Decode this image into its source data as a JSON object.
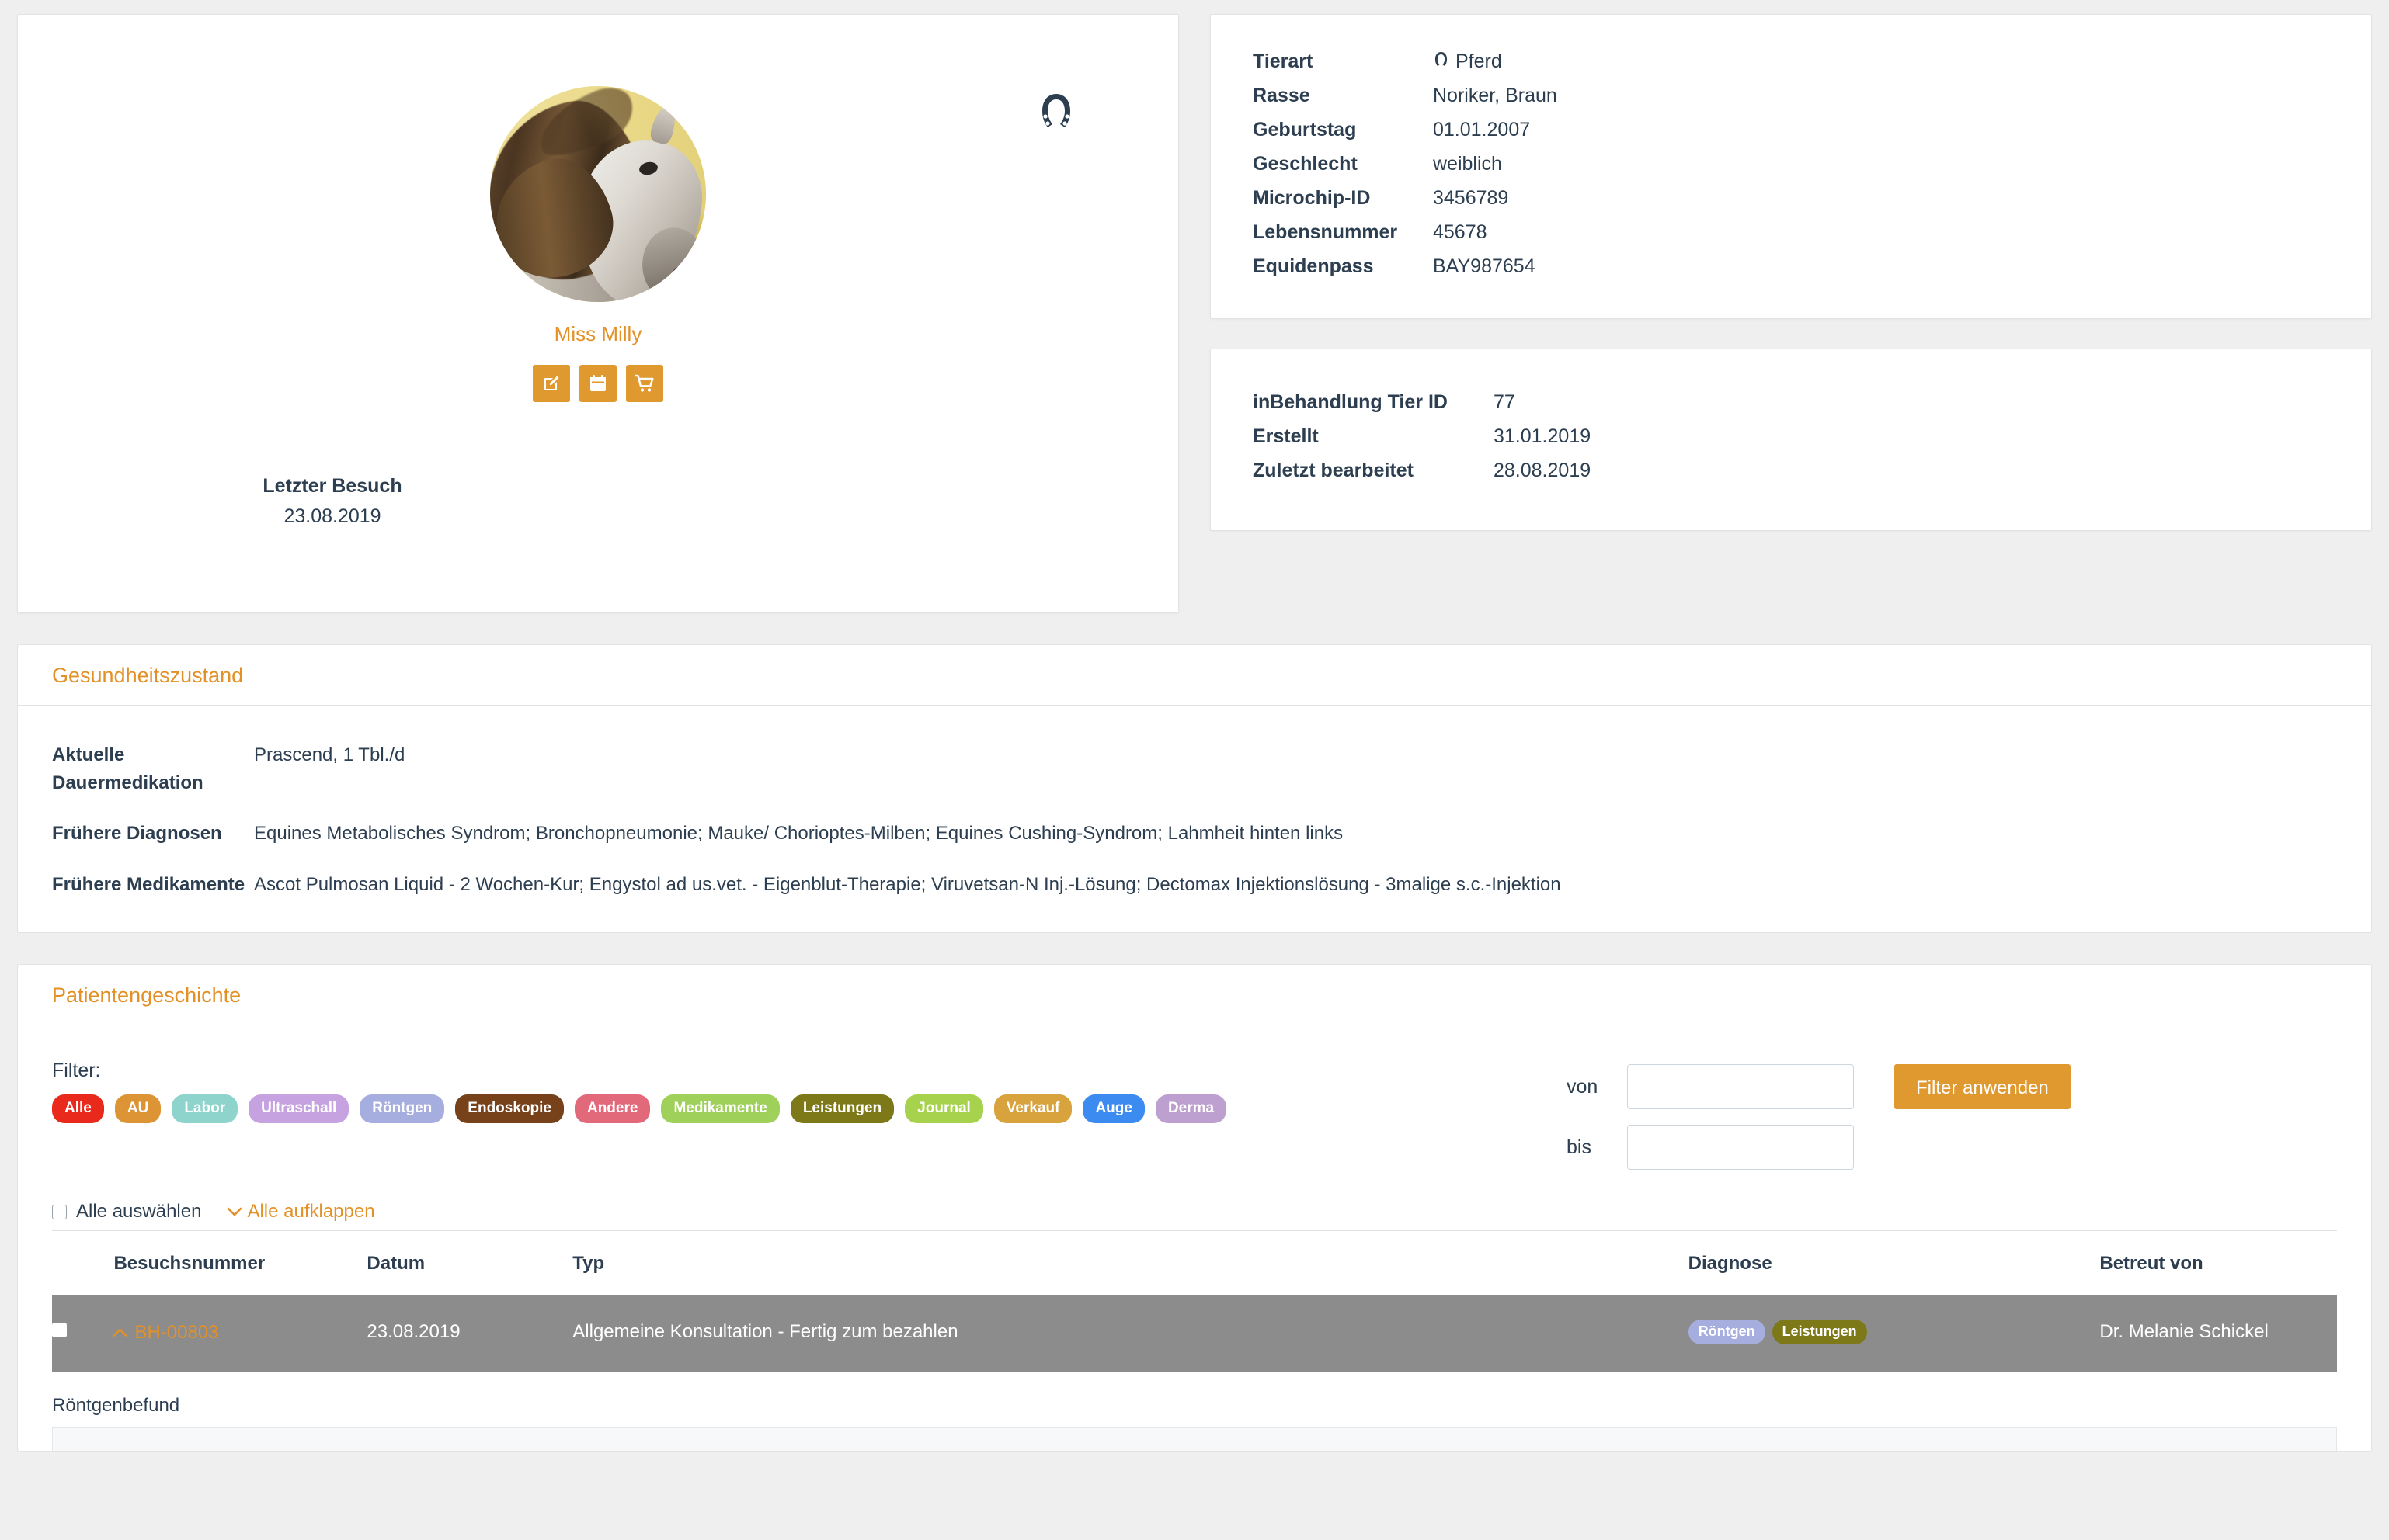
{
  "pet": {
    "name": "Miss Milly",
    "species_icon": "horseshoe-icon",
    "last_visit_label": "Letzter Besuch",
    "last_visit_date": "23.08.2019",
    "actions": [
      {
        "name": "edit-button",
        "icon": "pencil-square-icon"
      },
      {
        "name": "appointment-button",
        "icon": "calendar-icon"
      },
      {
        "name": "sell-button",
        "icon": "cart-icon"
      }
    ]
  },
  "details": [
    {
      "key": "Tierart",
      "value": "Pferd",
      "icon": "horseshoe-icon"
    },
    {
      "key": "Rasse",
      "value": "Noriker, Braun"
    },
    {
      "key": "Geburtstag",
      "value": "01.01.2007"
    },
    {
      "key": "Geschlecht",
      "value": "weiblich"
    },
    {
      "key": "Microchip-ID",
      "value": "3456789"
    },
    {
      "key": "Lebensnummer",
      "value": "45678"
    },
    {
      "key": "Equidenpass",
      "value": "BAY987654"
    }
  ],
  "meta": [
    {
      "key": "inBehandlung Tier ID",
      "value": "77"
    },
    {
      "key": "Erstellt",
      "value": "31.01.2019"
    },
    {
      "key": "Zuletzt bearbeitet",
      "value": "28.08.2019"
    }
  ],
  "health": {
    "title": "Gesundheitszustand",
    "rows": [
      {
        "key": "Aktuelle Dauermedikation",
        "value": "Prascend, 1 Tbl./d"
      },
      {
        "key": "Frühere Diagnosen",
        "value": "Equines Metabolisches Syndrom; Bronchopneumonie; Mauke/ Chorioptes-Milben; Equines Cushing-Syndrom; Lahmheit hinten links"
      },
      {
        "key": "Frühere Medikamente",
        "value": "Ascot Pulmosan Liquid - 2 Wochen-Kur; Engystol ad us.vet. - Eigenblut-Therapie; Viruvetsan-N Inj.-Lösung; Dectomax Injektionslösung - 3malige s.c.-Injektion"
      }
    ]
  },
  "history": {
    "title": "Patientengeschichte",
    "filter_label": "Filter:",
    "tags": [
      {
        "label": "Alle",
        "color": "#e8291c"
      },
      {
        "label": "AU",
        "color": "#dd9434"
      },
      {
        "label": "Labor",
        "color": "#8ed3cc"
      },
      {
        "label": "Ultraschall",
        "color": "#c6a3e0"
      },
      {
        "label": "Röntgen",
        "color": "#a6aee0"
      },
      {
        "label": "Endoskopie",
        "color": "#77411a"
      },
      {
        "label": "Andere",
        "color": "#e2697a"
      },
      {
        "label": "Medikamente",
        "color": "#9ed05a"
      },
      {
        "label": "Leistungen",
        "color": "#7d7918"
      },
      {
        "label": "Journal",
        "color": "#a6d24e"
      },
      {
        "label": "Verkauf",
        "color": "#d8a33c"
      },
      {
        "label": "Auge",
        "color": "#3b8bf0"
      },
      {
        "label": "Derma",
        "color": "#bda0cf"
      }
    ],
    "date_from_label": "von",
    "date_to_label": "bis",
    "date_from_value": "",
    "date_to_value": "",
    "apply_label": "Filter anwenden",
    "select_all_label": "Alle auswählen",
    "expand_all_label": "Alle aufklappen",
    "columns": [
      "Besuchsnummer",
      "Datum",
      "Typ",
      "Diagnose",
      "Betreut von"
    ],
    "rows": [
      {
        "number": "BH-00803",
        "date": "23.08.2019",
        "type": "Allgemeine Konsultation - Fertig zum bezahlen",
        "badges": [
          {
            "label": "Röntgen",
            "color": "#a6aee0"
          },
          {
            "label": "Leistungen",
            "color": "#7d7918"
          }
        ],
        "vet": "Dr. Melanie Schickel"
      }
    ],
    "detail_title": "Röntgenbefund"
  }
}
